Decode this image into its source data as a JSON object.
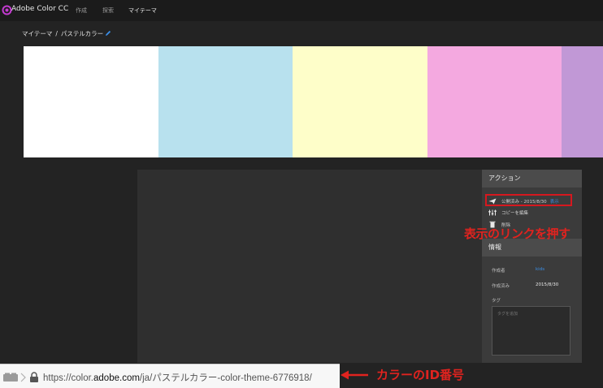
{
  "header": {
    "brand": "Adobe Color CC",
    "nav": [
      {
        "label": "作成",
        "active": false
      },
      {
        "label": "探索",
        "active": false
      },
      {
        "label": "マイテーマ",
        "active": true
      }
    ]
  },
  "breadcrumb": {
    "parent": "マイテーマ",
    "separator": "/",
    "current": "パステルカラー"
  },
  "palette": {
    "swatches": [
      "#ffffff",
      "#b8e1ee",
      "#fefec9",
      "#f4a9e0",
      "#c198d6"
    ]
  },
  "actions": {
    "title": "アクション",
    "items": [
      {
        "icon": "paper-plane-icon",
        "label": "公開済み - 2015/8/30",
        "link": "表示"
      },
      {
        "icon": "sliders-icon",
        "label": "コピーを編集",
        "link": ""
      },
      {
        "icon": "trash-icon",
        "label": "削除",
        "link": ""
      }
    ]
  },
  "info": {
    "title": "情報",
    "creator_label": "作成者",
    "creator_value": "kids",
    "published_label": "作成済み",
    "published_value": "2015/8/30",
    "tags_label": "タグ",
    "tags_placeholder": "タグを追加"
  },
  "annotations": {
    "link_note": "表示のリンクを押す",
    "id_note": "カラーのID番号"
  },
  "address_bar": {
    "prefix": "https://color.",
    "domain": "adobe.com",
    "path": "/ja/パステルカラー-color-theme-6776918/"
  },
  "colors": {
    "accent_link": "#3a8ee6",
    "annotation_red": "#e0231f"
  }
}
